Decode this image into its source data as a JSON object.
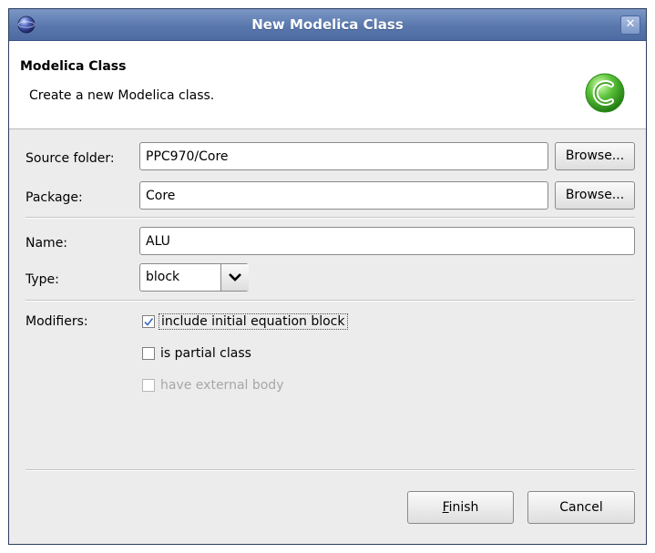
{
  "window": {
    "title": "New Modelica Class",
    "close_glyph": "✕"
  },
  "header": {
    "title": "Modelica Class",
    "description": "Create a new Modelica class."
  },
  "form": {
    "source_folder": {
      "label": "Source folder:",
      "value": "PPC970/Core",
      "browse_label": "Browse..."
    },
    "package": {
      "label": "Package:",
      "value": "Core",
      "browse_label": "Browse..."
    },
    "name": {
      "label": "Name:",
      "value": "ALU"
    },
    "type": {
      "label": "Type:",
      "value": "block"
    },
    "modifiers": {
      "label": "Modifiers:",
      "options": [
        {
          "label": "include initial equation block",
          "checked": true,
          "enabled": true
        },
        {
          "label": "is partial class",
          "checked": false,
          "enabled": true
        },
        {
          "label": "have external body",
          "checked": false,
          "enabled": false
        }
      ]
    }
  },
  "buttons": {
    "finish": {
      "mnemonic": "F",
      "rest": "inish"
    },
    "cancel": "Cancel"
  },
  "colors": {
    "titlebar": "#5a78ad",
    "logo_green": "#3fae2a",
    "check": "#3a6ec8"
  }
}
